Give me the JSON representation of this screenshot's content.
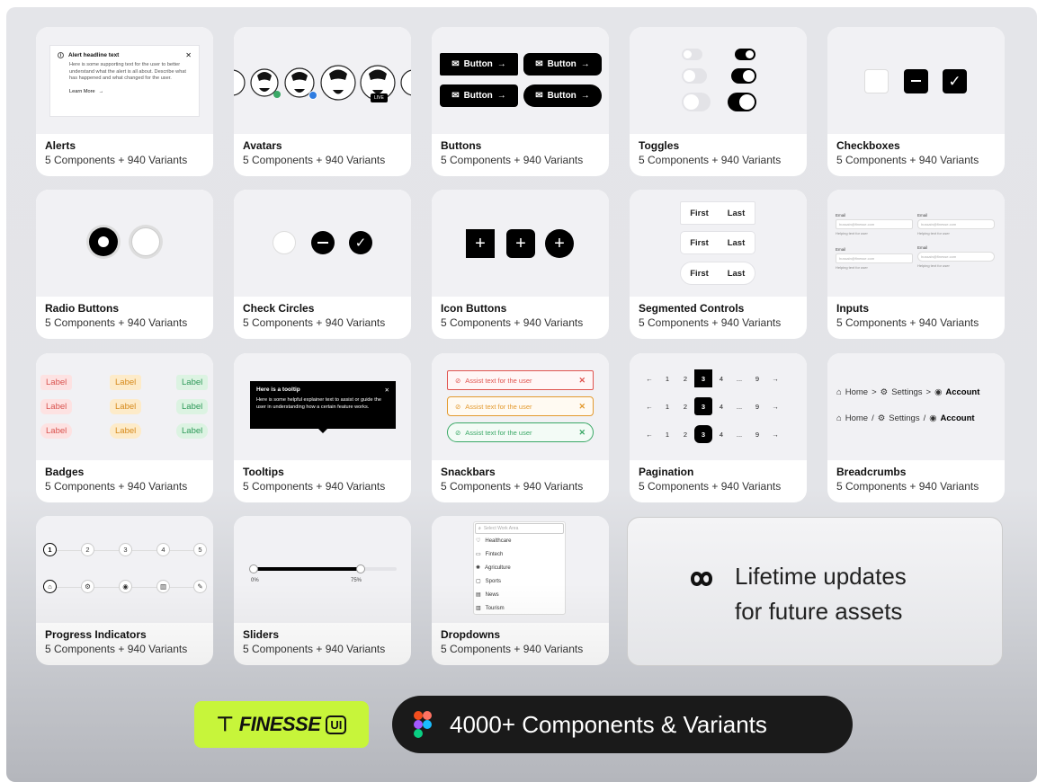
{
  "variant_text": "5 Components + 940 Variants",
  "cards": [
    {
      "title": "Alerts"
    },
    {
      "title": "Avatars"
    },
    {
      "title": "Buttons"
    },
    {
      "title": "Toggles"
    },
    {
      "title": "Checkboxes"
    },
    {
      "title": "Radio Buttons"
    },
    {
      "title": "Check Circles"
    },
    {
      "title": "Icon Buttons"
    },
    {
      "title": "Segmented Controls"
    },
    {
      "title": "Inputs"
    },
    {
      "title": "Badges"
    },
    {
      "title": "Tooltips"
    },
    {
      "title": "Snackbars"
    },
    {
      "title": "Pagination"
    },
    {
      "title": "Breadcrumbs"
    },
    {
      "title": "Progress Indicators"
    },
    {
      "title": "Sliders"
    },
    {
      "title": "Dropdowns"
    }
  ],
  "alert": {
    "headline": "Alert headline text",
    "body": "Here is some supporting text for the user to better understand what the alert is all about. Describe what has happened and what changed for the user.",
    "link": "Learn More"
  },
  "avatars": {
    "live": "LIVE"
  },
  "buttons": {
    "label": "Button"
  },
  "segmented": {
    "first": "First",
    "last": "Last"
  },
  "inputs": {
    "label": "Email",
    "placeholder": "hussain@finesse.com",
    "helper": "Helping text for user"
  },
  "badges": {
    "label": "Label",
    "colors": {
      "red": "#fde2e2",
      "orange": "#fdebc9",
      "green": "#dcf3e2"
    }
  },
  "tooltip": {
    "title": "Here is a tooltip",
    "body": "Here is some helpful explainer text to assist or guide the user in understanding how a certain feature works."
  },
  "snackbar": {
    "text": "Assist text for the user",
    "colors": {
      "error": "#e0544f",
      "warning": "#e39a2f",
      "success": "#3aa866"
    }
  },
  "pagination": {
    "pages": [
      "1",
      "2",
      "3",
      "4",
      "...",
      "9"
    ],
    "active": "3"
  },
  "breadcrumbs": {
    "home": "Home",
    "settings": "Settings",
    "account": "Account",
    "sep1": ">",
    "sep2": "/"
  },
  "progress": {
    "steps": [
      "1",
      "2",
      "3",
      "4",
      "5"
    ]
  },
  "slider": {
    "min_label": "0%",
    "max_label": "75%",
    "value": 0.75
  },
  "dropdown": {
    "placeholder": "Select Work Area",
    "items": [
      "Healthcare",
      "Fintech",
      "Agriculture",
      "Sports",
      "News",
      "Tourism"
    ]
  },
  "promo": {
    "line1": "Lifetime updates",
    "line2": "for future assets"
  },
  "logo": {
    "text": "FINESSE",
    "badge": "UI",
    "color": "#c7f53a"
  },
  "pill": {
    "text": "4000+ Components & Variants"
  }
}
